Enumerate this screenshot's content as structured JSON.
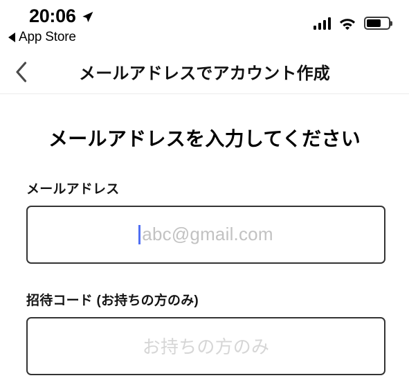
{
  "status_bar": {
    "time": "20:06",
    "location_icon": "location-arrow-icon",
    "back_app_label": "App Store",
    "back_app_icon": "back-triangle-icon",
    "signal_icon": "cellular-signal-icon",
    "signal_bars": 4,
    "wifi_icon": "wifi-icon",
    "battery_icon": "battery-icon",
    "battery_level_percent": 65
  },
  "nav_bar": {
    "back_icon": "chevron-left-icon",
    "title": "メールアドレスでアカウント作成"
  },
  "content": {
    "heading": "メールアドレスを入力してください",
    "fields": [
      {
        "label": "メールアドレス",
        "value": "",
        "placeholder": "abc@gmail.com",
        "focused": true
      },
      {
        "label": "招待コード (お持ちの方のみ)",
        "value": "",
        "placeholder": "お持ちの方のみ",
        "focused": false
      }
    ]
  },
  "colors": {
    "caret": "#4f6ef2",
    "input_border": "#333333",
    "placeholder": "#c2c2c2",
    "placeholder_light": "#d6d6d6",
    "divider": "#ececec",
    "text": "#000000"
  }
}
